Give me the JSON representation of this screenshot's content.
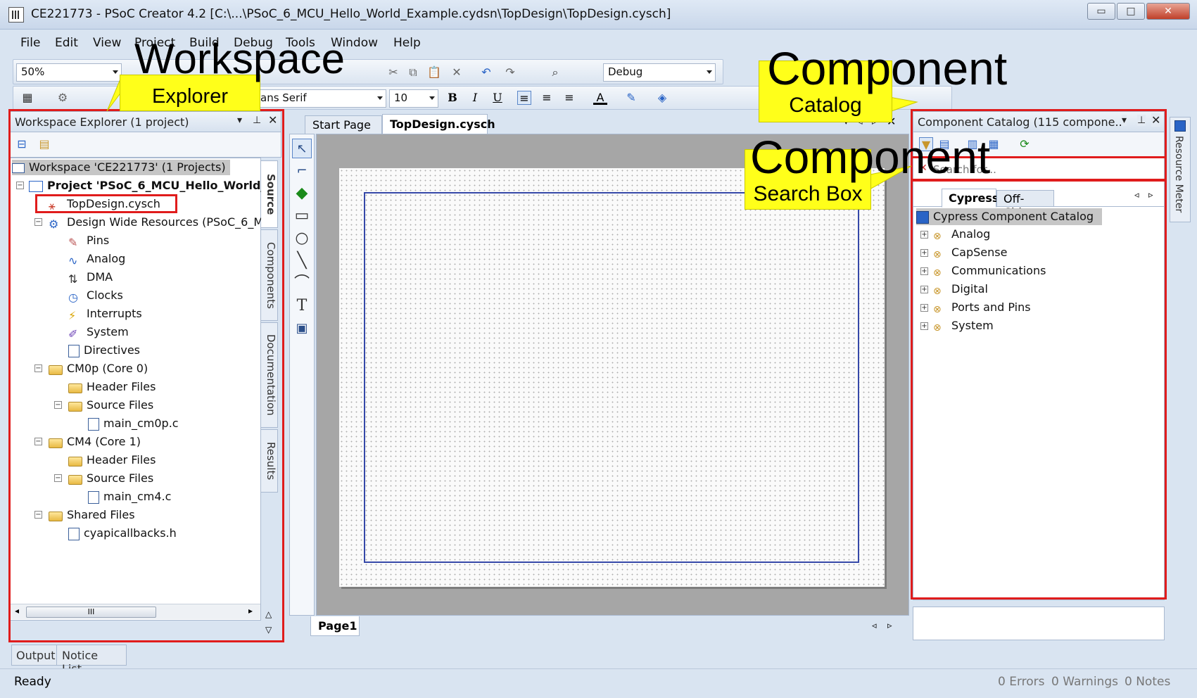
{
  "window": {
    "title": "CE221773 - PSoC Creator 4.2  [C:\\...\\PSoC_6_MCU_Hello_World_Example.cydsn\\TopDesign\\TopDesign.cysch]",
    "min_glyph": "▭",
    "max_glyph": "□",
    "close_glyph": "✕"
  },
  "menu": [
    "File",
    "Edit",
    "View",
    "Project",
    "Build",
    "Debug",
    "Tools",
    "Window",
    "Help"
  ],
  "toolbar": {
    "zoom_value": "50%",
    "config_value": "Debug",
    "font_value": "ans Serif",
    "font_size": "10",
    "bold": "B",
    "italic": "I",
    "underline": "U"
  },
  "workspace": {
    "header": "Workspace Explorer (1 project)",
    "workspace_row": "Workspace 'CE221773' (1 Projects)",
    "project_row": "Project  'PSoC_6_MCU_Hello_World_",
    "items": [
      "TopDesign.cysch",
      "Design Wide Resources (PSoC_6_M",
      "Pins",
      "Analog",
      "DMA",
      "Clocks",
      "Interrupts",
      "System",
      "Directives",
      "CM0p (Core 0)",
      "Header Files",
      "Source Files",
      "main_cm0p.c",
      "CM4 (Core 1)",
      "Header Files",
      "Source Files",
      "main_cm4.c",
      "Shared Files",
      "cyapicallbacks.h"
    ],
    "side_tabs": [
      "Source",
      "Components",
      "Documentation",
      "Results"
    ],
    "hscroll_label": "III"
  },
  "editor": {
    "tabs": [
      "Start Page",
      "TopDesign.cysch"
    ],
    "page_tab": "Page1"
  },
  "catalog": {
    "header": "Component Catalog (115 compone...",
    "search_placeholder": "Search for...",
    "tabs": [
      "Cypress",
      "Off-Chip"
    ],
    "root": "Cypress Component Catalog",
    "items": [
      "Analog",
      "CapSense",
      "Communications",
      "Digital",
      "Ports and Pins",
      "System"
    ],
    "right_tab": "Resource Meter"
  },
  "bottom_tabs": [
    "Output",
    "Notice List"
  ],
  "status": {
    "left": "Ready",
    "errors": "0 Errors",
    "warnings": "0 Warnings",
    "notes": "0 Notes"
  },
  "annotations": {
    "workspace_big": "Workspace",
    "workspace_small": "Explorer",
    "catalog_big": "Component",
    "catalog_small": "Catalog",
    "search_big": "Component",
    "search_small": "Search Box"
  }
}
